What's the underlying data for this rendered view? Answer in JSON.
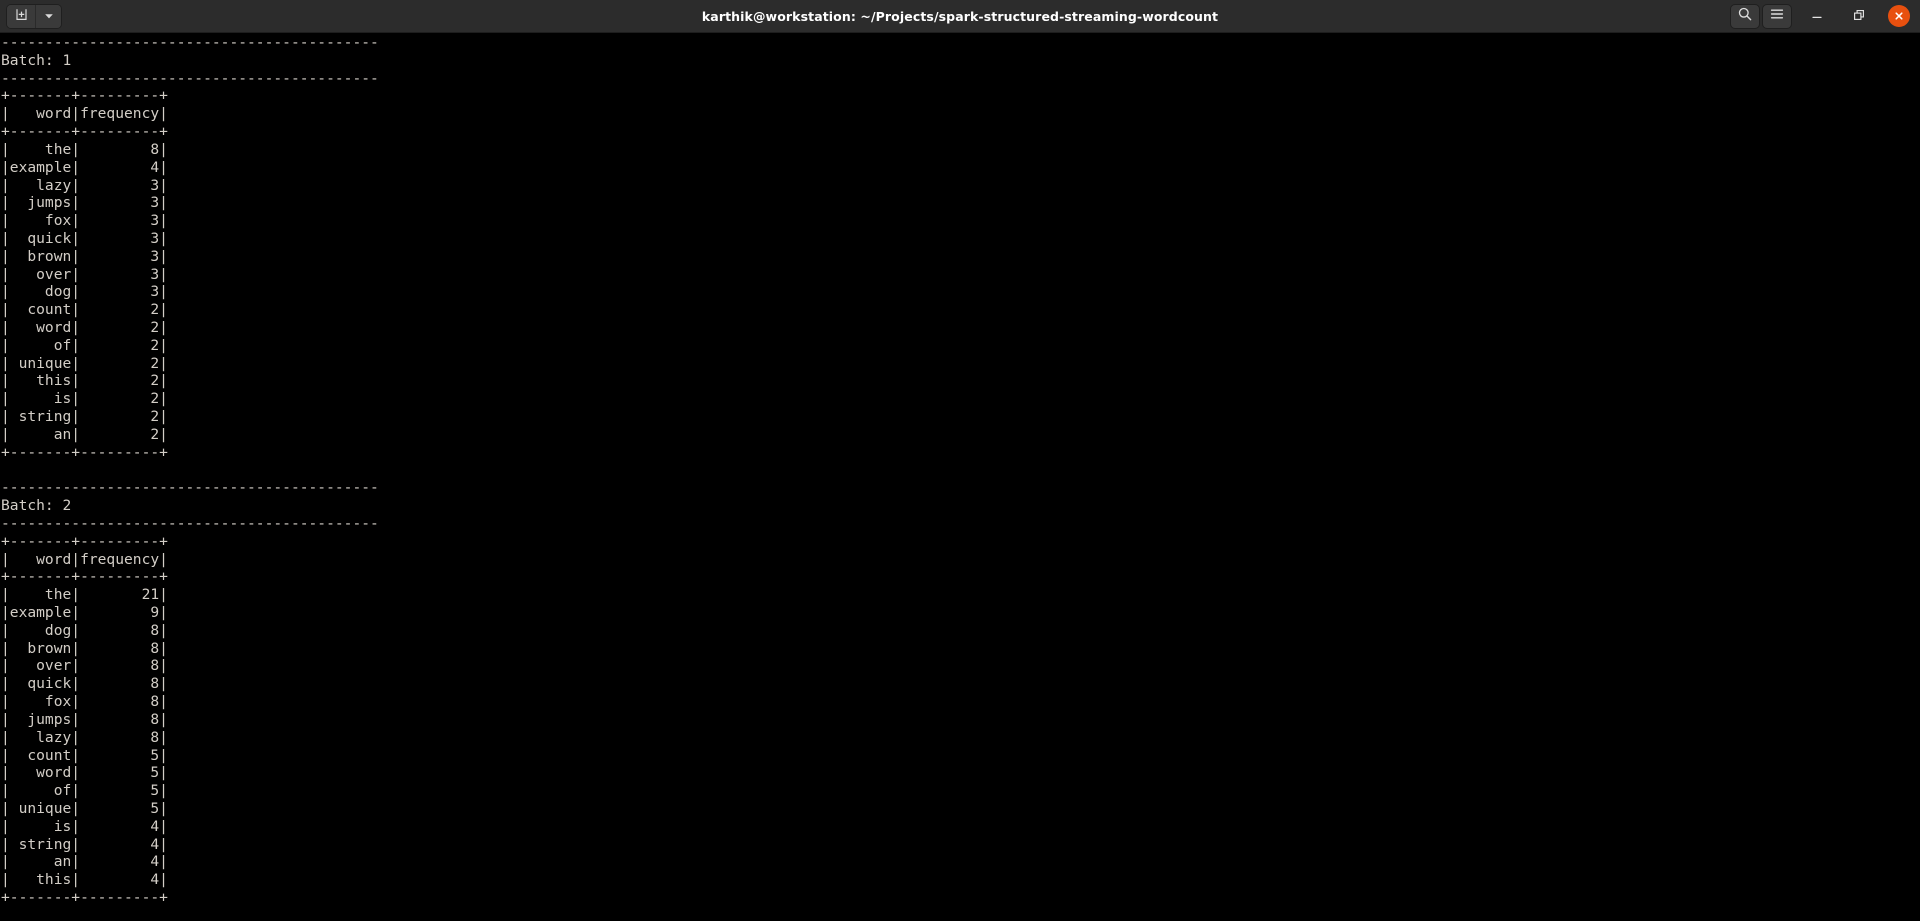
{
  "window": {
    "title": "karthik@workstation: ~/Projects/spark-structured-streaming-wordcount",
    "titlebar_bg": "#2c2c2c",
    "close_button_color": "#e8500f",
    "terminal_bg": "#000000",
    "terminal_fg": "#d3cec7"
  },
  "titlebar": {
    "new_tab_label": "New Tab",
    "tab_menu_label": "Tab Menu",
    "find_label": "Find",
    "menu_label": "Main Menu",
    "minimize_label": "Minimize",
    "maximize_label": "Restore",
    "close_label": "Close"
  },
  "terminal": {
    "batches": [
      {
        "separator": "-------------------------------------------",
        "header": "Batch: 1",
        "table_rule": "+-------+---------+",
        "column_header": "|   word|frequency|",
        "rows": [
          {
            "word": "the",
            "frequency": 8
          },
          {
            "word": "example",
            "frequency": 4
          },
          {
            "word": "lazy",
            "frequency": 3
          },
          {
            "word": "jumps",
            "frequency": 3
          },
          {
            "word": "fox",
            "frequency": 3
          },
          {
            "word": "quick",
            "frequency": 3
          },
          {
            "word": "brown",
            "frequency": 3
          },
          {
            "word": "over",
            "frequency": 3
          },
          {
            "word": "dog",
            "frequency": 3
          },
          {
            "word": "count",
            "frequency": 2
          },
          {
            "word": "word",
            "frequency": 2
          },
          {
            "word": "of",
            "frequency": 2
          },
          {
            "word": "unique",
            "frequency": 2
          },
          {
            "word": "this",
            "frequency": 2
          },
          {
            "word": "is",
            "frequency": 2
          },
          {
            "word": "string",
            "frequency": 2
          },
          {
            "word": "an",
            "frequency": 2
          }
        ]
      },
      {
        "separator": "-------------------------------------------",
        "header": "Batch: 2",
        "table_rule": "+-------+---------+",
        "column_header": "|   word|frequency|",
        "rows": [
          {
            "word": "the",
            "frequency": 21
          },
          {
            "word": "example",
            "frequency": 9
          },
          {
            "word": "dog",
            "frequency": 8
          },
          {
            "word": "brown",
            "frequency": 8
          },
          {
            "word": "over",
            "frequency": 8
          },
          {
            "word": "quick",
            "frequency": 8
          },
          {
            "word": "fox",
            "frequency": 8
          },
          {
            "word": "jumps",
            "frequency": 8
          },
          {
            "word": "lazy",
            "frequency": 8
          },
          {
            "word": "count",
            "frequency": 5
          },
          {
            "word": "word",
            "frequency": 5
          },
          {
            "word": "of",
            "frequency": 5
          },
          {
            "word": "unique",
            "frequency": 5
          },
          {
            "word": "is",
            "frequency": 4
          },
          {
            "word": "string",
            "frequency": 4
          },
          {
            "word": "an",
            "frequency": 4
          },
          {
            "word": "this",
            "frequency": 4
          }
        ]
      }
    ]
  }
}
